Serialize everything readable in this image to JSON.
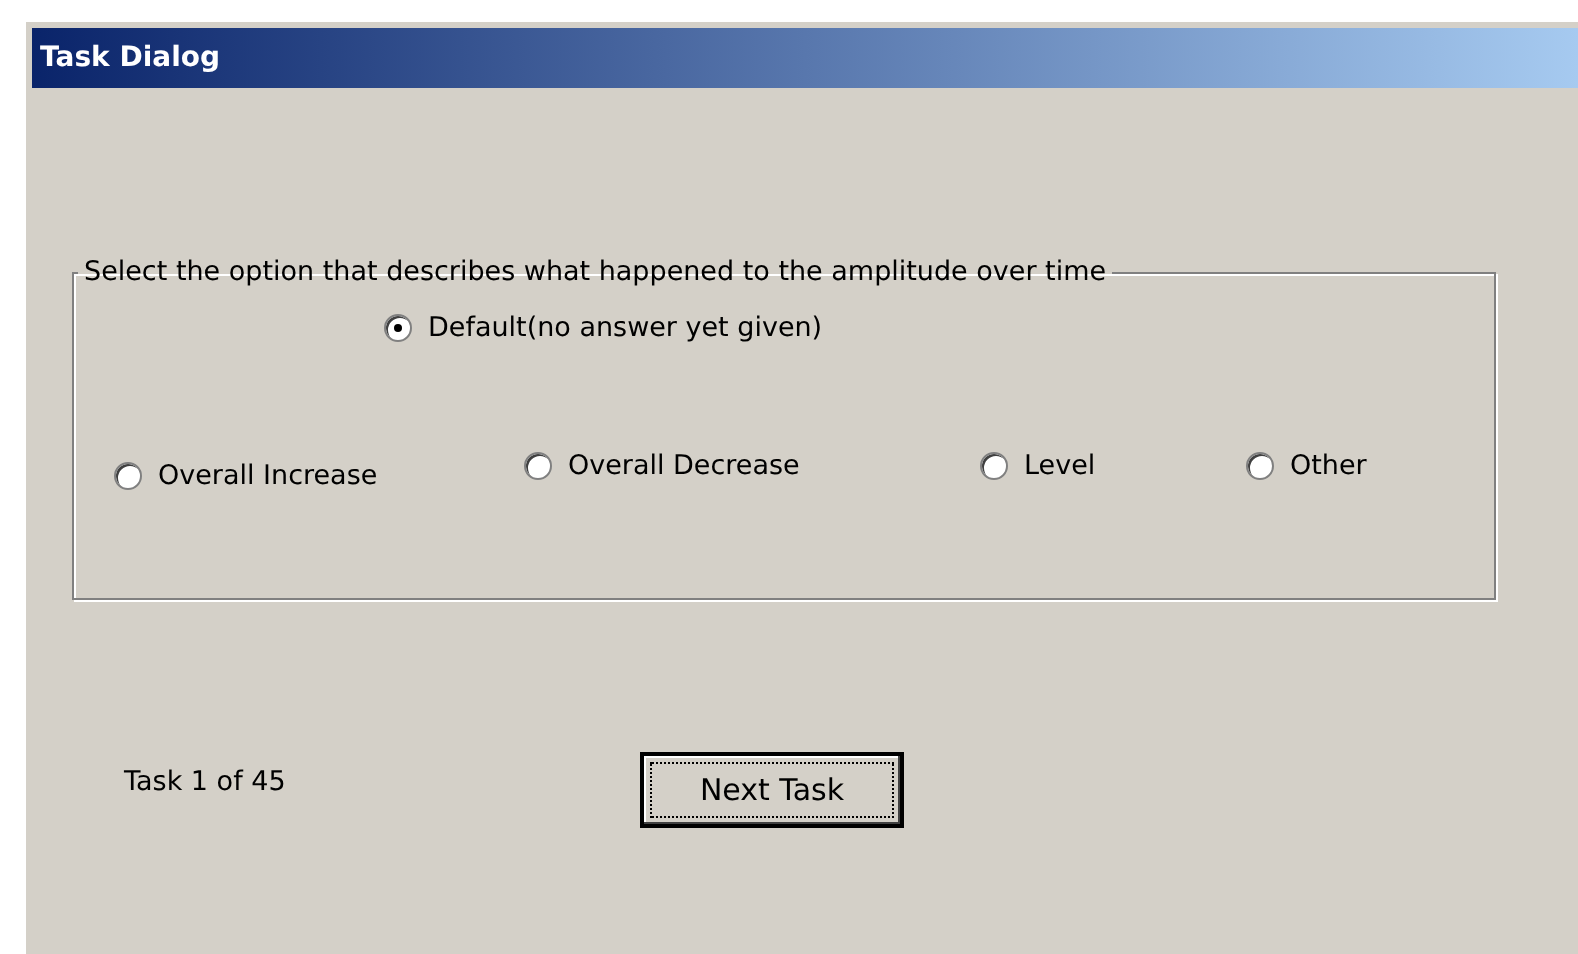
{
  "window": {
    "title": "Task Dialog"
  },
  "group": {
    "legend": "Select the option that describes what happened to the amplitude over time",
    "default_option": {
      "label": "Default(no answer yet given)",
      "selected": true
    },
    "options": [
      {
        "label": "Overall Increase",
        "selected": false
      },
      {
        "label": "Overall Decrease",
        "selected": false
      },
      {
        "label": "Level",
        "selected": false
      },
      {
        "label": "Other",
        "selected": false
      }
    ]
  },
  "task_counter": "Task 1 of 45",
  "buttons": [
    {
      "label": "Next Task"
    }
  ]
}
